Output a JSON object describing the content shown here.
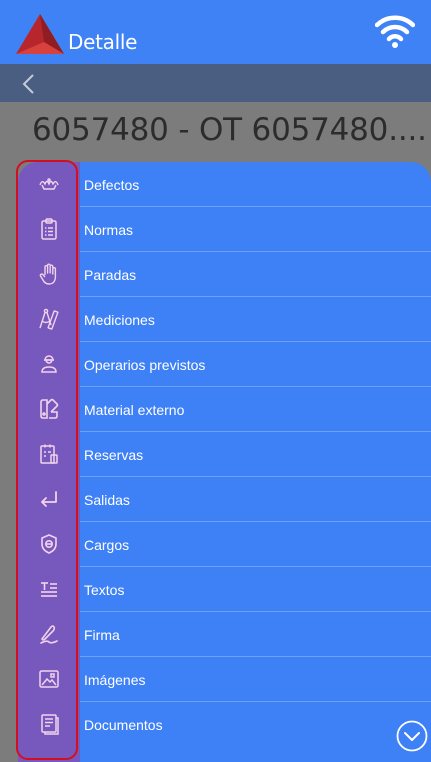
{
  "header": {
    "title": "Detalle",
    "brand_color": "#3f82f6",
    "logo_icon": "red-triangle-logo",
    "status_icon": "wifi-icon"
  },
  "navigation": {
    "back_icon": "chevron-left-icon"
  },
  "page_title": "6057480 - OT 6057480....",
  "menu": {
    "background_color": "#3e80f6",
    "icon_column_color": "#7758bd",
    "items": [
      {
        "label": "Defectos",
        "icon": "defects-icon"
      },
      {
        "label": "Normas",
        "icon": "clipboard-list-icon"
      },
      {
        "label": "Paradas",
        "icon": "hand-stop-icon"
      },
      {
        "label": "Mediciones",
        "icon": "compass-ruler-icon"
      },
      {
        "label": "Operarios previstos",
        "icon": "worker-icon"
      },
      {
        "label": "Material externo",
        "icon": "material-icon"
      },
      {
        "label": "Reservas",
        "icon": "reservations-icon"
      },
      {
        "label": "Salidas",
        "icon": "return-arrow-icon"
      },
      {
        "label": "Cargos",
        "icon": "shield-icon"
      },
      {
        "label": "Textos",
        "icon": "text-icon"
      },
      {
        "label": "Firma",
        "icon": "signature-icon"
      },
      {
        "label": "Imágenes",
        "icon": "image-icon"
      },
      {
        "label": "Documentos",
        "icon": "document-icon"
      }
    ]
  },
  "scroll_icon": "chevron-down-circle-icon"
}
